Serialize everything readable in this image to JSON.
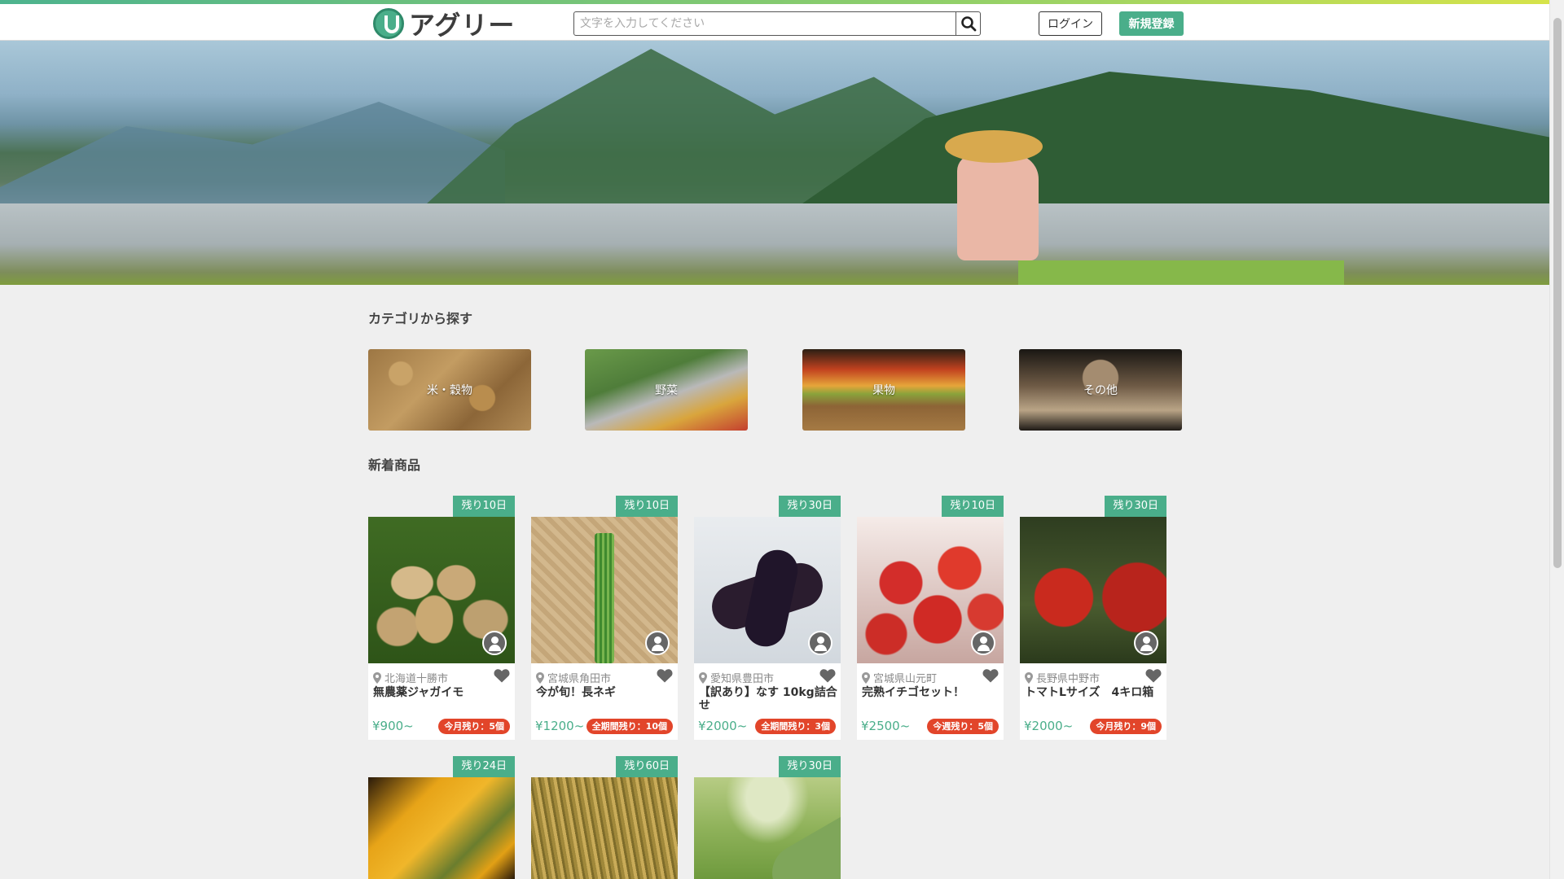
{
  "header": {
    "logo_text": "アグリー",
    "search_placeholder": "文字を入力してください",
    "login_label": "ログイン",
    "signup_label": "新規登録",
    "accent_color": "#4aae8a"
  },
  "categories_section": {
    "title": "カテゴリから探す",
    "items": [
      {
        "label": "米・穀物"
      },
      {
        "label": "野菜"
      },
      {
        "label": "果物"
      },
      {
        "label": "その他"
      }
    ]
  },
  "new_products": {
    "title": "新着商品",
    "items": [
      {
        "badge": "残り10日",
        "location": "北海道十勝市",
        "name": "無農薬ジャガイモ",
        "price": "¥900~",
        "stock": "今月残り：5個"
      },
      {
        "badge": "残り10日",
        "location": "宮城県角田市",
        "name": "今が旬！長ネギ",
        "price": "¥1200~",
        "stock": "全期間残り：10個"
      },
      {
        "badge": "残り30日",
        "location": "愛知県豊田市",
        "name": "【訳あり】なす 10kg詰合せ",
        "price": "¥2000~",
        "stock": "全期間残り：3個"
      },
      {
        "badge": "残り10日",
        "location": "宮城県山元町",
        "name": "完熟イチゴセット！",
        "price": "¥2500~",
        "stock": "今週残り：5個"
      },
      {
        "badge": "残り30日",
        "location": "長野県中野市",
        "name": "トマトLサイズ　4キロ箱",
        "price": "¥2000~",
        "stock": "今月残り：9個"
      },
      {
        "badge": "残り24日"
      },
      {
        "badge": "残り60日"
      },
      {
        "badge": "残り30日"
      }
    ]
  }
}
